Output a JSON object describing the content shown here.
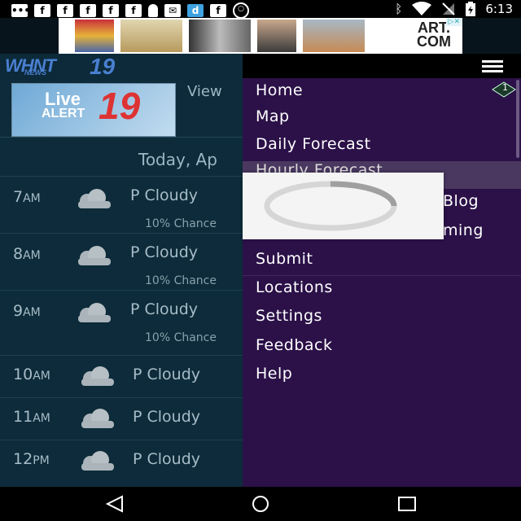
{
  "status_bar": {
    "time": "6:13",
    "left_icons": [
      "message-icon",
      "facebook-icon",
      "facebook-icon",
      "facebook-icon",
      "facebook-icon",
      "facebook-icon",
      "person-icon",
      "mail-icon",
      "dictionary-icon",
      "facebook-icon",
      "record-icon"
    ],
    "right_icons": [
      "bluetooth-icon",
      "wifi-icon",
      "no-sim-icon",
      "battery-charging-icon"
    ]
  },
  "ad": {
    "logo_line1": "ART.",
    "logo_line2": "COM",
    "adchoices": "▷✕"
  },
  "app": {
    "brand": "WHNT",
    "brand_sub": "NEWS",
    "brand_number": "19",
    "alert_live": "Live",
    "alert_word": "ALERT",
    "alert_number": "19",
    "view_link": "View",
    "date_heading": "Today, Ap",
    "hours": [
      {
        "time": "7",
        "ampm": "AM",
        "condition": "P Cloudy",
        "chance": "10% Chance"
      },
      {
        "time": "8",
        "ampm": "AM",
        "condition": "P Cloudy",
        "chance": "10% Chance"
      },
      {
        "time": "9",
        "ampm": "AM",
        "condition": "P Cloudy",
        "chance": "10% Chance"
      },
      {
        "time": "10",
        "ampm": "AM",
        "condition": "P Cloudy",
        "chance": ""
      },
      {
        "time": "11",
        "ampm": "AM",
        "condition": "P Cloudy",
        "chance": ""
      },
      {
        "time": "12",
        "ampm": "PM",
        "condition": "P Cloudy",
        "chance": ""
      }
    ]
  },
  "drawer": {
    "items": [
      {
        "label": "Home",
        "badge": "1"
      },
      {
        "label": "Map"
      },
      {
        "label": "Daily Forecast"
      },
      {
        "label": "Hourly Forecast"
      },
      {
        "label": "Blog"
      },
      {
        "label": "ming"
      },
      {
        "label": "Submit"
      },
      {
        "label": "Locations"
      },
      {
        "label": "Settings"
      },
      {
        "label": "Feedback"
      },
      {
        "label": "Help"
      }
    ]
  },
  "colors": {
    "drawer_bg": "#2b1148",
    "app_bg": "#0d2b3a",
    "accent_blue": "#4a7fd0",
    "alert_red": "#d33333"
  }
}
